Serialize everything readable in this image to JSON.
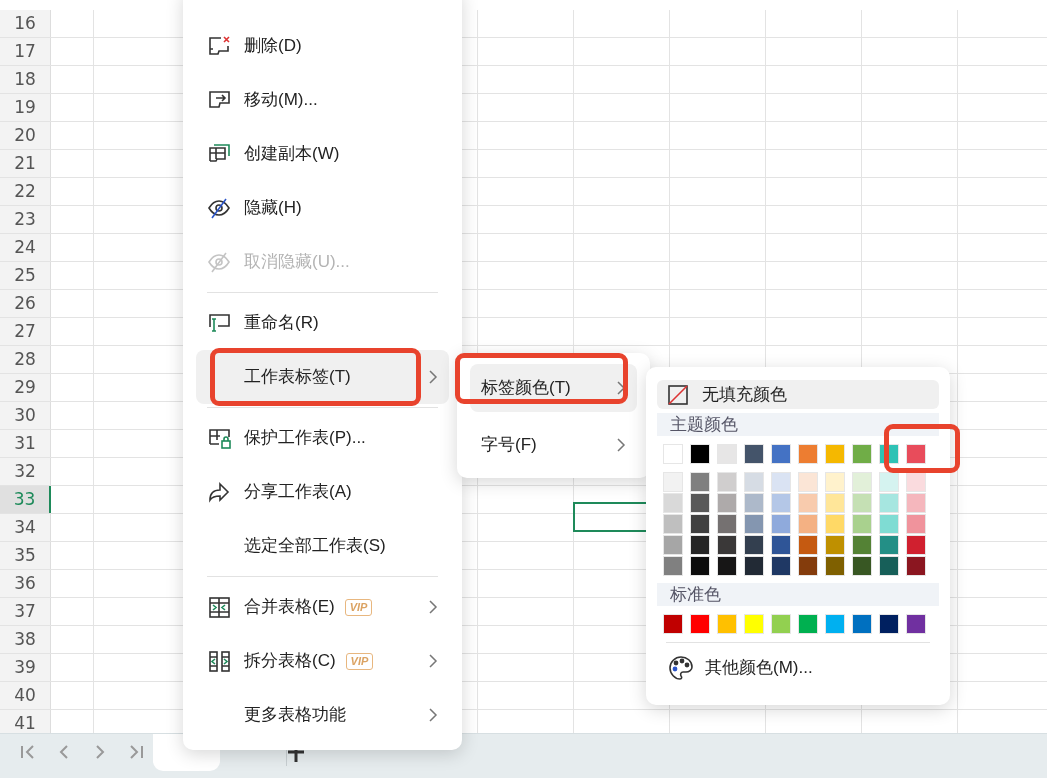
{
  "sheet": {
    "row_headers": [
      {
        "label": "16",
        "selected": false
      },
      {
        "label": "17",
        "selected": false
      },
      {
        "label": "18",
        "selected": false
      },
      {
        "label": "19",
        "selected": false
      },
      {
        "label": "20",
        "selected": false
      },
      {
        "label": "21",
        "selected": false
      },
      {
        "label": "22",
        "selected": false
      },
      {
        "label": "23",
        "selected": false
      },
      {
        "label": "24",
        "selected": false
      },
      {
        "label": "25",
        "selected": false
      },
      {
        "label": "26",
        "selected": false
      },
      {
        "label": "27",
        "selected": false
      },
      {
        "label": "28",
        "selected": false
      },
      {
        "label": "29",
        "selected": false
      },
      {
        "label": "30",
        "selected": false
      },
      {
        "label": "31",
        "selected": false
      },
      {
        "label": "32",
        "selected": false
      },
      {
        "label": "33",
        "selected": true
      },
      {
        "label": "34",
        "selected": false
      },
      {
        "label": "35",
        "selected": false
      },
      {
        "label": "36",
        "selected": false
      },
      {
        "label": "37",
        "selected": false
      },
      {
        "label": "38",
        "selected": false
      },
      {
        "label": "39",
        "selected": false
      },
      {
        "label": "40",
        "selected": false
      },
      {
        "label": "41",
        "selected": false
      }
    ]
  },
  "sheet_tabs": {
    "tabs": [
      {
        "selected": true
      },
      {
        "selected": false
      }
    ]
  },
  "context_menu": {
    "items": [
      {
        "kind": "command",
        "label": "删除(D)",
        "disabled": false,
        "highlighted": false,
        "submenu": false
      },
      {
        "kind": "command",
        "label": "移动(M)...",
        "disabled": false,
        "highlighted": false,
        "submenu": false
      },
      {
        "kind": "command",
        "label": "创建副本(W)",
        "disabled": false,
        "highlighted": false,
        "submenu": false
      },
      {
        "kind": "command",
        "label": "隐藏(H)",
        "disabled": false,
        "highlighted": false,
        "submenu": false
      },
      {
        "kind": "command",
        "label": "取消隐藏(U)...",
        "disabled": true,
        "highlighted": false,
        "submenu": false
      },
      {
        "kind": "divider"
      },
      {
        "kind": "command",
        "label": "重命名(R)",
        "disabled": false,
        "highlighted": false,
        "submenu": false
      },
      {
        "kind": "command",
        "label": "工作表标签(T)",
        "disabled": false,
        "highlighted": true,
        "submenu": true
      },
      {
        "kind": "divider"
      },
      {
        "kind": "command",
        "label": "保护工作表(P)...",
        "disabled": false,
        "highlighted": false,
        "submenu": false
      },
      {
        "kind": "command",
        "label": "分享工作表(A)",
        "disabled": false,
        "highlighted": false,
        "submenu": false
      },
      {
        "kind": "command",
        "label": "选定全部工作表(S)",
        "disabled": false,
        "highlighted": false,
        "submenu": false
      },
      {
        "kind": "divider"
      },
      {
        "kind": "command",
        "label": "合并表格(E)",
        "badge": "VIP",
        "disabled": false,
        "highlighted": false,
        "submenu": true
      },
      {
        "kind": "command",
        "label": "拆分表格(C)",
        "badge": "VIP",
        "disabled": false,
        "highlighted": false,
        "submenu": true
      },
      {
        "kind": "command",
        "label": "更多表格功能",
        "disabled": false,
        "highlighted": false,
        "submenu": true
      }
    ]
  },
  "tab_submenu": {
    "items": [
      {
        "label": "标签颜色(T)",
        "highlighted": true,
        "submenu": true
      },
      {
        "label": "字号(F)",
        "highlighted": false,
        "submenu": true
      }
    ]
  },
  "color_menu": {
    "no_fill": {
      "label": "无填充颜色",
      "highlighted": true
    },
    "theme_heading": "主题颜色",
    "theme_colors": [
      {
        "color": "#ffffff"
      },
      {
        "color": "#000000"
      },
      {
        "color": "#e7e6e6"
      },
      {
        "color": "#44546a"
      },
      {
        "color": "#4472c4"
      },
      {
        "color": "#ed7d31"
      },
      {
        "color": "#f5b800"
      },
      {
        "color": "#70ad47"
      },
      {
        "color": "#2fc2b5"
      },
      {
        "color": "#e84c5b"
      }
    ],
    "theme_shades": [
      [
        {
          "color": "#f2f2f2"
        },
        {
          "color": "#7f7f7f"
        },
        {
          "color": "#d0cece"
        },
        {
          "color": "#d6dce4"
        },
        {
          "color": "#dae3f3"
        },
        {
          "color": "#fbe5d6"
        },
        {
          "color": "#fff2cc"
        },
        {
          "color": "#e2f0d9"
        },
        {
          "color": "#d5f3f0"
        },
        {
          "color": "#fadbde"
        }
      ],
      [
        {
          "color": "#d9d9d9"
        },
        {
          "color": "#595959"
        },
        {
          "color": "#aeaaaa"
        },
        {
          "color": "#adb9ca"
        },
        {
          "color": "#b4c7e7"
        },
        {
          "color": "#f8cbad"
        },
        {
          "color": "#ffe699"
        },
        {
          "color": "#c5e0b4"
        },
        {
          "color": "#a6e6e0"
        },
        {
          "color": "#f5b7bd"
        }
      ],
      [
        {
          "color": "#bfbfbf"
        },
        {
          "color": "#404040"
        },
        {
          "color": "#757171"
        },
        {
          "color": "#8496b0"
        },
        {
          "color": "#8faadc"
        },
        {
          "color": "#f4b183"
        },
        {
          "color": "#ffd966"
        },
        {
          "color": "#a9d18e"
        },
        {
          "color": "#7fdcd3"
        },
        {
          "color": "#f0939c"
        }
      ],
      [
        {
          "color": "#a6a6a6"
        },
        {
          "color": "#262626"
        },
        {
          "color": "#3a3838"
        },
        {
          "color": "#333f4f"
        },
        {
          "color": "#2f5597"
        },
        {
          "color": "#c55a11"
        },
        {
          "color": "#bf9000"
        },
        {
          "color": "#548235"
        },
        {
          "color": "#238f86"
        },
        {
          "color": "#d0202f"
        }
      ],
      [
        {
          "color": "#808080"
        },
        {
          "color": "#0d0d0d"
        },
        {
          "color": "#171616"
        },
        {
          "color": "#222a35"
        },
        {
          "color": "#1f3864"
        },
        {
          "color": "#843c0c"
        },
        {
          "color": "#7f6000"
        },
        {
          "color": "#385723"
        },
        {
          "color": "#175f59"
        },
        {
          "color": "#8b1620"
        }
      ]
    ],
    "standard_heading": "标准色",
    "standard_colors": [
      {
        "color": "#c00000"
      },
      {
        "color": "#ff0000"
      },
      {
        "color": "#ffc000"
      },
      {
        "color": "#ffff00"
      },
      {
        "color": "#92d050"
      },
      {
        "color": "#00b050"
      },
      {
        "color": "#00b0f0"
      },
      {
        "color": "#0070c0"
      },
      {
        "color": "#002060"
      },
      {
        "color": "#7030a0"
      }
    ],
    "more_colors": "其他颜色(M)..."
  }
}
